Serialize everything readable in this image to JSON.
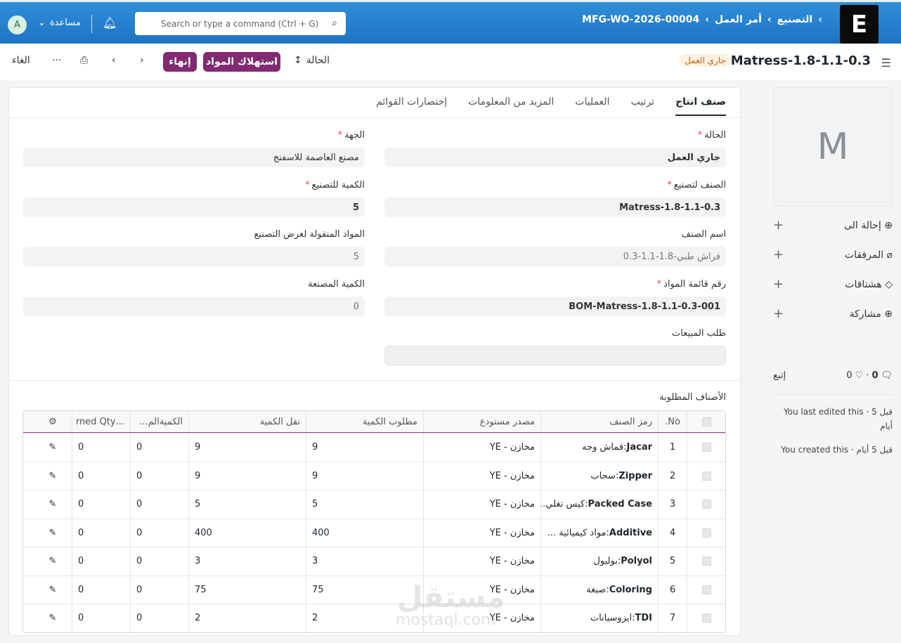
{
  "topbar": {
    "logo": "E",
    "breadcrumbs": [
      "التصنيع",
      "أمر العمل",
      "MFG-WO-2026-00004"
    ],
    "search_placeholder": "Search or type a command (Ctrl + G)",
    "help_label": "مساعدة",
    "avatar_initial": "A"
  },
  "page": {
    "title": "Matress-1.8-1.1-0.3",
    "status_badge": "جاري العمل",
    "status_label": "الحالة",
    "consume_button": "استهلاك المواد",
    "finish_button": "إنهاء",
    "cancel_button": "الغاء"
  },
  "tabs": [
    "صنف انتاج",
    "ترتيب",
    "العمليات",
    "المزيد من المعلومات",
    "إختصارات القوائم"
  ],
  "form": {
    "status": {
      "label": "الحالة",
      "value": "جاري العمل"
    },
    "company": {
      "label": "الجهة",
      "value": "مصنع العاصمة للاسفنج"
    },
    "production_item": {
      "label": "الصنف لتصنيع",
      "value": "Matress-1.8-1.1-0.3"
    },
    "qty": {
      "label": "الكمية للتصنيع",
      "value": "5"
    },
    "item_name": {
      "label": "اسم الصنف",
      "value": "فراش طبي-1.8-1.1-0.3"
    },
    "material_transferred": {
      "label": "المواد المنقولة لغرض التصنيع",
      "value": "5"
    },
    "bom_no": {
      "label": "رقم قائمة المواد",
      "value": "BOM-Matress-1.8-1.1-0.3-001"
    },
    "produced_qty": {
      "label": "الكمية المصنعة",
      "value": "0"
    },
    "sales_order": {
      "label": "طلب المبيعات",
      "value": ""
    }
  },
  "required_items": {
    "title": "الأصناف المطلوبة",
    "headers": [
      "No.",
      "رمز الصنف",
      "مصدر مستودع",
      "مطلوب الكمية",
      "نقل الكمية",
      "الكميةالم...",
      "...rned Qty"
    ],
    "rows": [
      {
        "no": "1",
        "code": "Jacar",
        "name": "قماش وجه",
        "warehouse": "مخازن - YE",
        "required": "9",
        "transferred": "9",
        "consumed": "0",
        "returned": "0"
      },
      {
        "no": "2",
        "code": "Zipper",
        "name": "سحاب",
        "warehouse": "مخازن - YE",
        "required": "9",
        "transferred": "9",
        "consumed": "0",
        "returned": "0"
      },
      {
        "no": "3",
        "code": "Packed Case",
        "name": "كيس تغلي...",
        "warehouse": "مخازن - YE",
        "required": "5",
        "transferred": "5",
        "consumed": "0",
        "returned": "0"
      },
      {
        "no": "4",
        "code": "Additive",
        "name": "مواد كيميائية ...",
        "warehouse": "مخازن - YE",
        "required": "400",
        "transferred": "400",
        "consumed": "0",
        "returned": "0"
      },
      {
        "no": "5",
        "code": "Polyol",
        "name": "بوليول",
        "warehouse": "مخازن - YE",
        "required": "3",
        "transferred": "3",
        "consumed": "0",
        "returned": "0"
      },
      {
        "no": "6",
        "code": "Coloring",
        "name": "صبغة",
        "warehouse": "مخازن - YE",
        "required": "75",
        "transferred": "75",
        "consumed": "0",
        "returned": "0"
      },
      {
        "no": "7",
        "code": "TDI",
        "name": "ايزوسيانات",
        "warehouse": "مخازن - YE",
        "required": "2",
        "transferred": "2",
        "consumed": "0",
        "returned": "0"
      }
    ]
  },
  "sidebar": {
    "image_initial": "M",
    "items": [
      "إحالة الى",
      "المرفقات",
      "هشتاقات",
      "مشاركة"
    ],
    "follow": "إتبع",
    "comments": "0",
    "likes": "0",
    "activity": [
      "You last edited this · قبل 5 أيام",
      "You created this · قبل 5 أيام"
    ]
  },
  "watermark": {
    "text": "مستقل",
    "sub": "mostaql.com"
  }
}
